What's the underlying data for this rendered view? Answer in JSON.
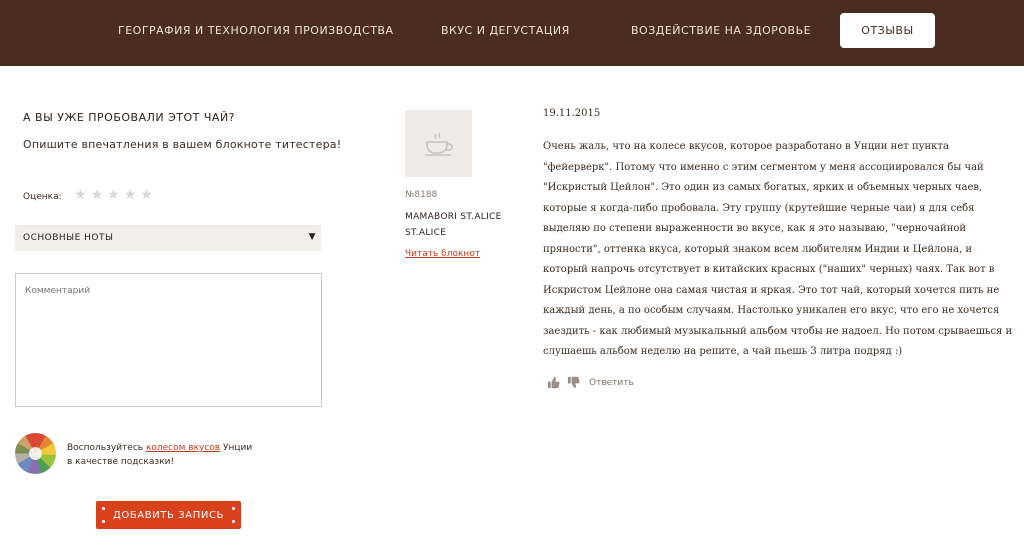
{
  "nav": {
    "items": [
      {
        "label": "География и технология производства"
      },
      {
        "label": "Вкус и дегустация"
      },
      {
        "label": "Воздействие на здоровье"
      }
    ],
    "active_tab": "Отзывы"
  },
  "form": {
    "heading": "А вы уже пробовали этот чай?",
    "subtitle": "Опишите впечатления в вашем блокноте титестера!",
    "rating_label": "Оценка:",
    "rating_stars": 5,
    "rating_value": 0,
    "notes_select": "Основные ноты",
    "comment_placeholder": "Комментарий",
    "hint_before": "Воспользуйтесь ",
    "hint_link": "колесом вкусов",
    "hint_after": " Унции",
    "hint_line2": "в качестве подсказки!",
    "submit_label": "Добавить запись"
  },
  "review": {
    "user_number": "№8188",
    "user_name_line1": "Mamabori st.alice",
    "user_name_line2": "st.alice",
    "notebook_link": "Читать блокнот",
    "date": "19.11.2015",
    "text": "Очень жаль, что на колесе вкусов, которое разработано в Унции нет пункта \"фейерверк\". Потому что именно с этим сегментом у меня ассоциировался бы чай \"Искристый Цейлон\". Это один из самых богатых, ярких и объемных черных чаев, которые я когда-либо пробовала. Эту группу (крутейшие черные чаи) я для себя выделяю по степени выраженности во вкусе, как я это называю, \"черночайной пряности\", оттенка вкуса, который знаком всем любителям Индии и Цейлона, и который напрочь отсутствует в китайских красных (\"наших\" черных) чаях. Так вот в Искристом Цейлоне она самая чистая и яркая. Это тот чай, который хочется пить не каждый день, а по особым случаям. Настолько уникален его вкус, что его не хочется заездить - как любимый музыкальный альбом чтобы не надоел. Но потом срываешься и слушаешь альбом неделю на репите, а чай пьешь 3 литра подряд :)",
    "reply_label": "Ответить"
  },
  "colors": {
    "nav_bg": "#4a2c20",
    "accent": "#d8411c",
    "link": "#c23c1e"
  }
}
